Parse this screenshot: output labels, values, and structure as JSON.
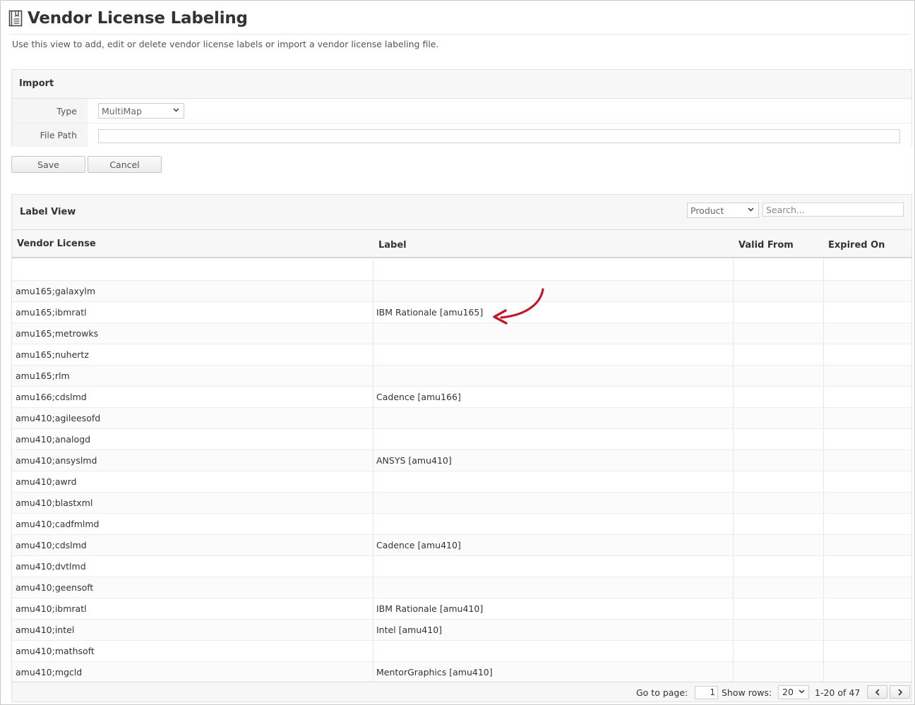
{
  "page": {
    "title": "Vendor License Labeling",
    "description": "Use this view to add, edit or delete vendor license labels or import a vendor license labeling file.",
    "icon": "book-icon"
  },
  "import": {
    "title": "Import",
    "type_label": "Type",
    "type_value": "MultiMap",
    "file_path_label": "File Path",
    "file_path_value": ""
  },
  "buttons": {
    "save": "Save",
    "cancel": "Cancel"
  },
  "label_view": {
    "title": "Label View",
    "filter_value": "Product",
    "search_placeholder": "Search...",
    "columns": [
      "Vendor License",
      "Label",
      "Valid From",
      "Expired On"
    ],
    "rows": [
      {
        "vendor_license": "",
        "label": "",
        "valid_from": "",
        "expired_on": ""
      },
      {
        "vendor_license": "amu165;galaxylm",
        "label": "",
        "valid_from": "",
        "expired_on": ""
      },
      {
        "vendor_license": "amu165;ibmratl",
        "label": "IBM Rationale [amu165]",
        "valid_from": "",
        "expired_on": ""
      },
      {
        "vendor_license": "amu165;metrowks",
        "label": "",
        "valid_from": "",
        "expired_on": ""
      },
      {
        "vendor_license": "amu165;nuhertz",
        "label": "",
        "valid_from": "",
        "expired_on": ""
      },
      {
        "vendor_license": "amu165;rlm",
        "label": "",
        "valid_from": "",
        "expired_on": ""
      },
      {
        "vendor_license": "amu166;cdslmd",
        "label": "Cadence [amu166]",
        "valid_from": "",
        "expired_on": ""
      },
      {
        "vendor_license": "amu410;agileesofd",
        "label": "",
        "valid_from": "",
        "expired_on": ""
      },
      {
        "vendor_license": "amu410;analogd",
        "label": "",
        "valid_from": "",
        "expired_on": ""
      },
      {
        "vendor_license": "amu410;ansyslmd",
        "label": "ANSYS [amu410]",
        "valid_from": "",
        "expired_on": ""
      },
      {
        "vendor_license": "amu410;awrd",
        "label": "",
        "valid_from": "",
        "expired_on": ""
      },
      {
        "vendor_license": "amu410;blastxml",
        "label": "",
        "valid_from": "",
        "expired_on": ""
      },
      {
        "vendor_license": "amu410;cadfmlmd",
        "label": "",
        "valid_from": "",
        "expired_on": ""
      },
      {
        "vendor_license": "amu410;cdslmd",
        "label": "Cadence [amu410]",
        "valid_from": "",
        "expired_on": ""
      },
      {
        "vendor_license": "amu410;dvtlmd",
        "label": "",
        "valid_from": "",
        "expired_on": ""
      },
      {
        "vendor_license": "amu410;geensoft",
        "label": "",
        "valid_from": "",
        "expired_on": ""
      },
      {
        "vendor_license": "amu410;ibmratl",
        "label": "IBM Rationale [amu410]",
        "valid_from": "",
        "expired_on": ""
      },
      {
        "vendor_license": "amu410;intel",
        "label": "Intel [amu410]",
        "valid_from": "",
        "expired_on": ""
      },
      {
        "vendor_license": "amu410;mathsoft",
        "label": "",
        "valid_from": "",
        "expired_on": ""
      },
      {
        "vendor_license": "amu410;mgcld",
        "label": "MentorGraphics [amu410]",
        "valid_from": "",
        "expired_on": ""
      }
    ]
  },
  "pagination": {
    "goto_label": "Go to page:",
    "current_page": "1",
    "show_rows_label": "Show rows:",
    "rows_per_page": "20",
    "range": "1-20 of 47",
    "prev": "<",
    "next": ">"
  },
  "colors": {
    "annotation_arrow": "#c0182a",
    "panel_bg": "#f7f7f7",
    "border": "#e2e2e2"
  }
}
